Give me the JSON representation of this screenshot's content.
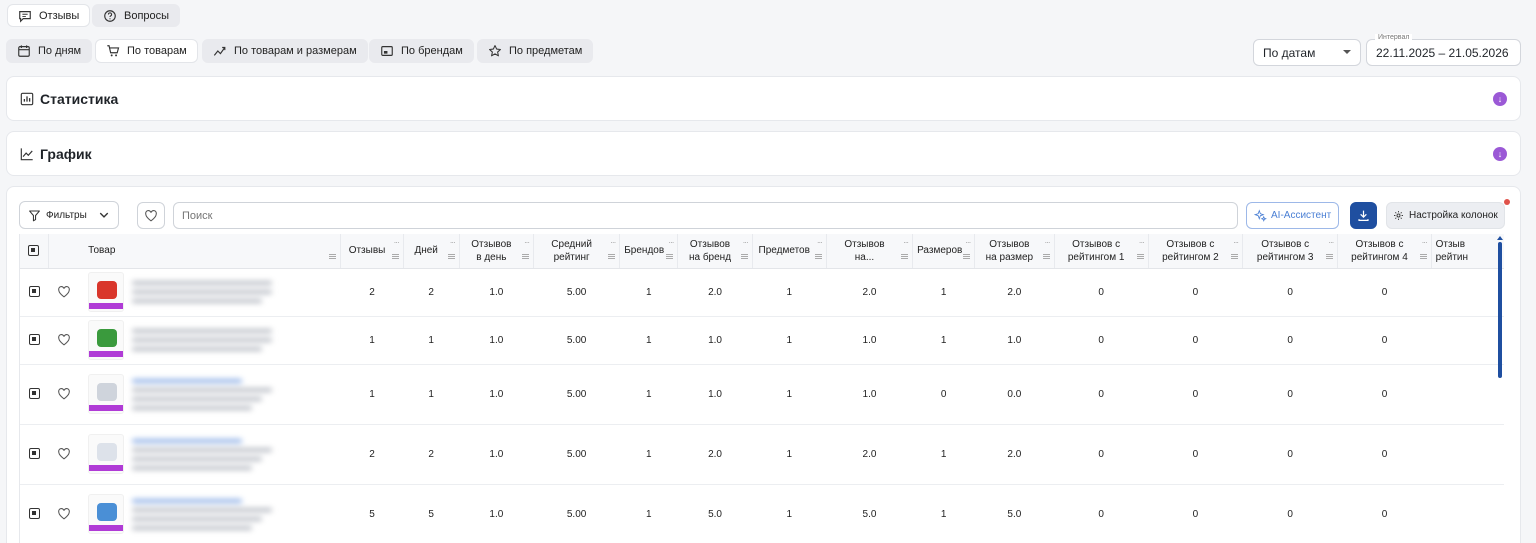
{
  "top_tabs": {
    "reviews": "Отзывы",
    "questions": "Вопросы"
  },
  "group_tabs": {
    "by_days": "По дням",
    "by_products": "По товарам",
    "by_products_sizes": "По товарам и размерам",
    "by_brands": "По брендам",
    "by_subjects": "По предметам"
  },
  "date_mode": {
    "value": "По датам"
  },
  "interval": {
    "label": "Интервал",
    "value": "22.11.2025 – 21.05.2026"
  },
  "panels": {
    "statistics": "Статистика",
    "chart": "График"
  },
  "toolbar": {
    "filters": "Фильтры",
    "search_placeholder": "Поиск",
    "ai_assistant": "AI-Ассистент",
    "column_settings": "Настройка колонок"
  },
  "table": {
    "headers": {
      "product": "Товар",
      "c1": "Отзывы",
      "c2": "Дней",
      "c3a": "Отзывов",
      "c3b": "в день",
      "c4a": "Средний",
      "c4b": "рейтинг",
      "c5": "Брендов",
      "c6a": "Отзывов",
      "c6b": "на бренд",
      "c7": "Предметов",
      "c8a": "Отзывов",
      "c8b": "на...",
      "c9": "Размеров",
      "c10a": "Отзывов",
      "c10b": "на размер",
      "c11a": "Отзывов с",
      "c11b": "рейтингом 1",
      "c12a": "Отзывов с",
      "c12b": "рейтингом 2",
      "c13a": "Отзывов с",
      "c13b": "рейтингом 3",
      "c14a": "Отзывов с",
      "c14b": "рейтингом 4",
      "c15a": "Отзыв",
      "c15b": "рейтин"
    },
    "rows": [
      {
        "v": [
          "2",
          "2",
          "1.0",
          "5.00",
          "1",
          "2.0",
          "1",
          "2.0",
          "1",
          "2.0",
          "0",
          "0",
          "0",
          "0"
        ],
        "color": "#d9362b"
      },
      {
        "v": [
          "1",
          "1",
          "1.0",
          "5.00",
          "1",
          "1.0",
          "1",
          "1.0",
          "1",
          "1.0",
          "0",
          "0",
          "0",
          "0"
        ],
        "color": "#3a9a3d"
      },
      {
        "v": [
          "1",
          "1",
          "1.0",
          "5.00",
          "1",
          "1.0",
          "1",
          "1.0",
          "0",
          "0.0",
          "0",
          "0",
          "0",
          "0"
        ],
        "color": "#cfd4dc"
      },
      {
        "v": [
          "2",
          "2",
          "1.0",
          "5.00",
          "1",
          "2.0",
          "1",
          "2.0",
          "1",
          "2.0",
          "0",
          "0",
          "0",
          "0"
        ],
        "color": "#dde2ea"
      },
      {
        "v": [
          "5",
          "5",
          "1.0",
          "5.00",
          "1",
          "5.0",
          "1",
          "5.0",
          "1",
          "5.0",
          "0",
          "0",
          "0",
          "0"
        ],
        "color": "#4a8fd6"
      }
    ]
  },
  "colors": {
    "accent_purple": "#9b59d6",
    "download_blue": "#1f4fa0",
    "ai_blue": "#4a7fd4"
  }
}
